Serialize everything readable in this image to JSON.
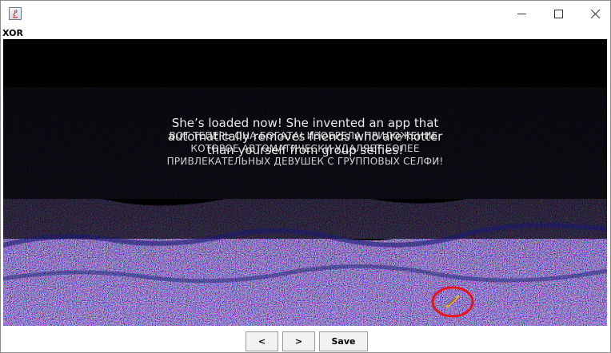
{
  "window": {
    "title": "",
    "header_label": "XOR",
    "controls": {
      "minimize": "minimize-icon",
      "maximize": "maximize-icon",
      "close": "close-icon"
    }
  },
  "image": {
    "caption_en": [
      "She’s loaded now! She invented an app that",
      "automatically removes friends who are hotter",
      "than yourself from group selfies!"
    ],
    "caption_ru": [
      "ВОТ ТЕПЕРЬ ОНА БОГАТА! ИЗОБРЕЛА ПРИЛОЖЕНИЕ,",
      "КОТОРОЕ АВТОМАТИЧЕСКИ УДАЛЯЕТ БОЛЕЕ",
      "ПРИВЛЕКАТЕЛЬНЫХ ДЕВУШЕК С ГРУППОВЫХ СЕЛФИ!"
    ],
    "highlight_color": "#e8141c",
    "background_color": "#000000"
  },
  "footer": {
    "prev_label": "<",
    "next_label": ">",
    "save_label": "Save"
  }
}
